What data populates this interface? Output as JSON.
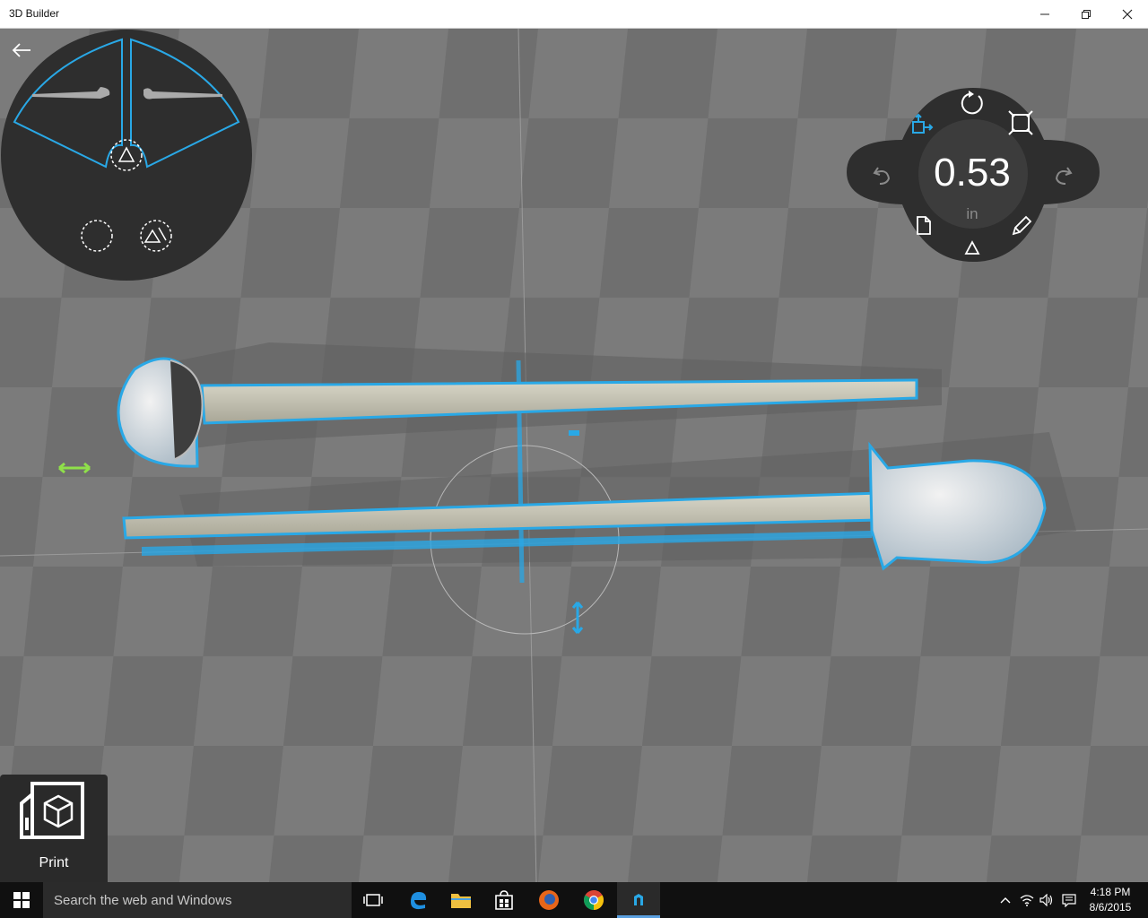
{
  "app": {
    "title": "3D Builder"
  },
  "window_controls": {
    "minimize": "minimize",
    "restore": "restore",
    "close": "close"
  },
  "controller": {
    "value": "0.53",
    "unit": "in"
  },
  "print_tile": {
    "label": "Print"
  },
  "taskbar": {
    "search_placeholder": "Search the web and Windows",
    "time": "4:18 PM",
    "date": "8/6/2015"
  },
  "colors": {
    "accent": "#29a8e6",
    "move_handle_green": "#8fe04a",
    "panel_dark": "#333333"
  }
}
